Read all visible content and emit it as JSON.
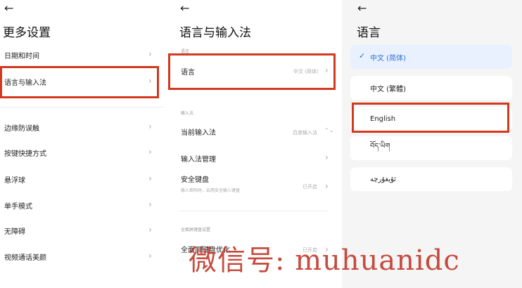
{
  "panel1": {
    "back": "←",
    "title": "更多设置",
    "items": [
      {
        "label": "日期和时间"
      },
      {
        "label": "语言与输入法"
      },
      {
        "label": "边缘防误触"
      },
      {
        "label": "按键快捷方式"
      },
      {
        "label": "悬浮球"
      },
      {
        "label": "单手模式"
      },
      {
        "label": "无障碍"
      },
      {
        "label": "视频通话美颜"
      }
    ]
  },
  "panel2": {
    "back": "←",
    "title": "语言与输入法",
    "section_language": "语言",
    "language_label": "语言",
    "language_value": "中文 (简体)",
    "section_input": "输入法",
    "current_ime_label": "当前输入法",
    "current_ime_value": "百度输入法",
    "ime_manage_label": "输入法管理",
    "secure_kb_label": "安全键盘",
    "secure_kb_sub": "输入密码时，启用安全输入键盘",
    "secure_kb_value": "已开启",
    "section_fullscreen": "全面屏键盘设置",
    "fullscreen_kb_label": "全面屏键盘优化",
    "fullscreen_kb_value": "已开启"
  },
  "panel3": {
    "back": "←",
    "title": "语言",
    "check": "✓",
    "options": [
      {
        "label": "中文 (简体)",
        "selected": true
      },
      {
        "label": "中文 (繁體)"
      },
      {
        "label": "English"
      },
      {
        "label": "བོད་ཡིག"
      },
      {
        "label": "ئۇيغۇرچە"
      }
    ]
  },
  "chevron": "›",
  "updown": "⌃⌄",
  "watermark": "微信号: muhuanidc",
  "colors": {
    "highlight": "#d2391f",
    "accent": "#2f6fd8",
    "selected_bg": "#e8f1fd"
  }
}
